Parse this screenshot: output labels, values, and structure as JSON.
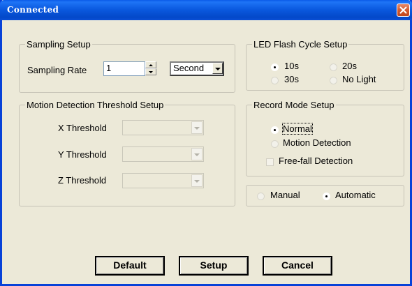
{
  "window": {
    "title": "Connected"
  },
  "sampling": {
    "group_title": "Sampling Setup",
    "rate_label": "Sampling Rate",
    "rate_value": "1",
    "unit_value": "Second"
  },
  "led": {
    "group_title": "LED Flash Cycle Setup",
    "options": [
      "10s",
      "20s",
      "30s",
      "No Light"
    ],
    "selected": "10s"
  },
  "motion": {
    "group_title": "Motion Detection Threshold Setup",
    "x_label": "X Threshold",
    "y_label": "Y Threshold",
    "z_label": "Z Threshold"
  },
  "record": {
    "group_title": "Record Mode Setup",
    "normal_label": "Normal",
    "motion_label": "Motion Detection",
    "freefall_label": "Free-fall Detection",
    "selected": "Normal"
  },
  "mode": {
    "manual_label": "Manual",
    "automatic_label": "Automatic",
    "selected": "Automatic"
  },
  "buttons": {
    "default_label": "Default",
    "setup_label": "Setup",
    "cancel_label": "Cancel"
  },
  "colors": {
    "titlebar": "#0a5ae8",
    "dialog_bg": "#ece9d8",
    "close_red": "#d45a2e"
  }
}
